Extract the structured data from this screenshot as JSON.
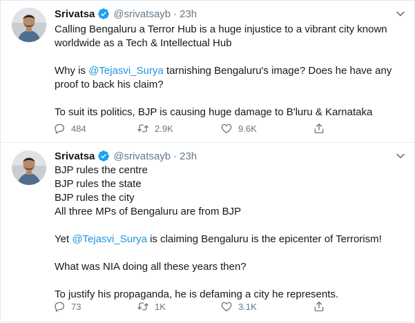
{
  "tweets": [
    {
      "author": {
        "name": "Srivatsa",
        "handle": "@srivatsayb",
        "separator": "·",
        "time": "23h"
      },
      "body": {
        "p1": "Calling Bengaluru a Terror Hub is a huge injustice to a vibrant city known worldwide as a Tech & Intellectual Hub",
        "p2_before": "Why is ",
        "p2_mention": "@Tejasvi_Surya",
        "p2_after": " tarnishing Bengaluru's image? Does he have any proof to back his claim?",
        "p3": "To suit its politics, BJP is causing huge damage to B'luru & Karnataka"
      },
      "stats": {
        "replies": "484",
        "retweets": "2.9K",
        "likes": "9.6K"
      }
    },
    {
      "author": {
        "name": "Srivatsa",
        "handle": "@srivatsayb",
        "separator": "·",
        "time": "23h"
      },
      "body": {
        "l1": "BJP rules the centre",
        "l2": "BJP rules the state",
        "l3": "BJP rules the city",
        "l4": "All three MPs of Bengaluru are from BJP",
        "p2_before": "Yet ",
        "p2_mention": "@Tejasvi_Surya",
        "p2_after": " is claiming Bengaluru is the epicenter of Terrorism!",
        "p3": "What was NIA doing all these years then?",
        "p4": "To justify his propaganda, he is defaming a city he represents."
      },
      "stats": {
        "replies": "73",
        "retweets": "1K",
        "likes": "3.1K"
      }
    }
  ],
  "colors": {
    "text": "#14171a",
    "muted": "#657786",
    "link": "#1b95e0",
    "verified": "#1da1f2",
    "border": "#e6ecf0"
  },
  "icons": [
    "avatar",
    "verified-badge-icon",
    "chevron-down-icon",
    "reply-icon",
    "retweet-icon",
    "like-icon",
    "share-icon"
  ]
}
